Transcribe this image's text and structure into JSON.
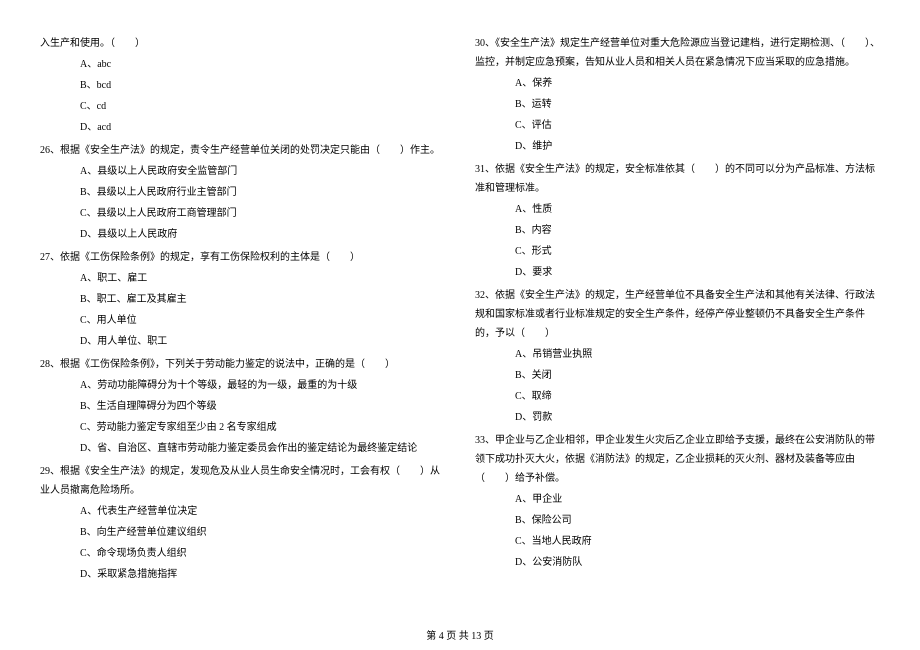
{
  "left": {
    "q25_tail": "入生产和使用。（　　）",
    "q25_options": [
      "A、abc",
      "B、bcd",
      "C、cd",
      "D、acd"
    ],
    "q26": "26、根据《安全生产法》的规定，责令生产经营单位关闭的处罚决定只能由（　　）作主。",
    "q26_options": [
      "A、县级以上人民政府安全监管部门",
      "B、县级以上人民政府行业主管部门",
      "C、县级以上人民政府工商管理部门",
      "D、县级以上人民政府"
    ],
    "q27": "27、依据《工伤保险条例》的规定，享有工伤保险权利的主体是（　　）",
    "q27_options": [
      "A、职工、雇工",
      "B、职工、雇工及其雇主",
      "C、用人单位",
      "D、用人单位、职工"
    ],
    "q28": "28、根据《工伤保险条例》，下列关于劳动能力鉴定的说法中，正确的是（　　）",
    "q28_options": [
      "A、劳动功能障碍分为十个等级，最轻的为一级，最重的为十级",
      "B、生活自理障碍分为四个等级",
      "C、劳动能力鉴定专家组至少由 2 名专家组成",
      "D、省、自治区、直辖市劳动能力鉴定委员会作出的鉴定结论为最终鉴定结论"
    ],
    "q29": "29、根据《安全生产法》的规定，发现危及从业人员生命安全情况时，工会有权（　　）从业人员撤离危险场所。",
    "q29_options": [
      "A、代表生产经营单位决定",
      "B、向生产经营单位建议组织",
      "C、命令现场负责人组织",
      "D、采取紧急措施指挥"
    ]
  },
  "right": {
    "q30": "30、《安全生产法》规定生产经营单位对重大危险源应当登记建档，进行定期检测、（　　）、监控，并制定应急预案，告知从业人员和相关人员在紧急情况下应当采取的应急措施。",
    "q30_options": [
      "A、保养",
      "B、运转",
      "C、评估",
      "D、维护"
    ],
    "q31": "31、依据《安全生产法》的规定，安全标准依其（　　）的不同可以分为产品标准、方法标准和管理标准。",
    "q31_options": [
      "A、性质",
      "B、内容",
      "C、形式",
      "D、要求"
    ],
    "q32": "32、依据《安全生产法》的规定，生产经营单位不具备安全生产法和其他有关法律、行政法规和国家标准或者行业标准规定的安全生产条件，经停产停业整顿仍不具备安全生产条件的，予以（　　）",
    "q32_options": [
      "A、吊销营业执照",
      "B、关闭",
      "C、取缔",
      "D、罚款"
    ],
    "q33": "33、甲企业与乙企业相邻，甲企业发生火灾后乙企业立即给予支援，最终在公安消防队的带领下成功扑灭大火，依据《消防法》的规定，乙企业损耗的灭火剂、器材及装备等应由（　　）给予补偿。",
    "q33_options": [
      "A、甲企业",
      "B、保险公司",
      "C、当地人民政府",
      "D、公安消防队"
    ]
  },
  "footer": "第 4 页 共 13 页"
}
